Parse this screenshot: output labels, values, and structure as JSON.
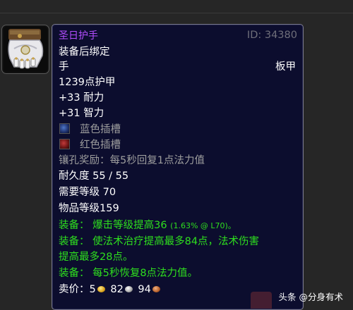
{
  "item": {
    "name": "圣日护手",
    "id_text": "ID: 34380",
    "bind": "装备后绑定",
    "slot": "手",
    "armor_type": "板甲",
    "armor": "1239点护甲",
    "stats": [
      "+33 耐力",
      "+31 智力"
    ],
    "sockets": [
      {
        "color": "blue",
        "label": "蓝色插槽"
      },
      {
        "color": "red",
        "label": "红色插槽"
      }
    ],
    "socket_bonus": "镶孔奖励：每5秒回复1点法力值",
    "durability": "耐久度 55 / 55",
    "required_level": "需要等级 70",
    "item_level": "物品等级159",
    "equip_effects": [
      {
        "prefix": "装备：",
        "text": "爆击等级提高36",
        "note": "(1.63% @ L70)。"
      },
      {
        "prefix": "装备：",
        "text": "使法术治疗提高最多84点，法术伤害"
      },
      {
        "prefix": "",
        "text": "提高最多28点。"
      },
      {
        "prefix": "装备：",
        "text": "每5秒恢复8点法力值。"
      }
    ],
    "sell_price": {
      "label": "卖价：",
      "gold": "5",
      "silver": "82",
      "copper": "94"
    }
  },
  "icon": "gauntlet-icon",
  "colors": {
    "tooltip_bg": "#0c0d2e",
    "epic_purple": "#b34dff",
    "equip_green": "#2ede1e",
    "id_gray": "#6f6f7a"
  },
  "watermark": {
    "text": "头条 @分身有术"
  }
}
